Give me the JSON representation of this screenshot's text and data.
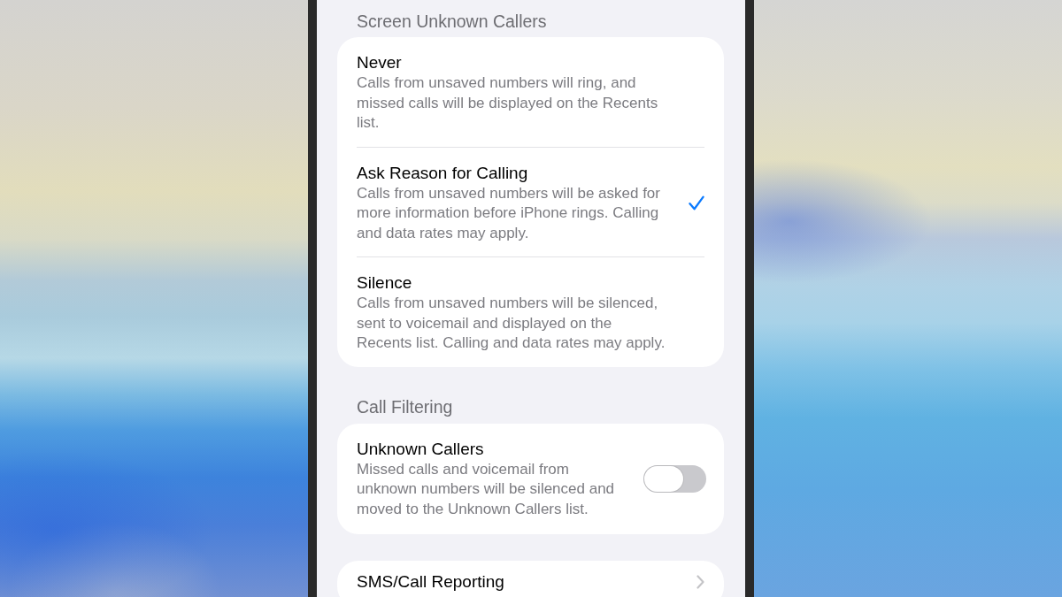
{
  "screen_unknown_callers": {
    "header": "Screen Unknown Callers",
    "options": [
      {
        "title": "Never",
        "description": "Calls from unsaved numbers will ring, and missed calls will be displayed on the Recents list.",
        "selected": false
      },
      {
        "title": "Ask Reason for Calling",
        "description": "Calls from unsaved numbers will be asked for more information before iPhone rings. Calling and data rates may apply.",
        "selected": true
      },
      {
        "title": "Silence",
        "description": "Calls from unsaved numbers will be silenced, sent to voicemail and displayed on the Recents list. Calling and data rates may apply.",
        "selected": false
      }
    ]
  },
  "call_filtering": {
    "header": "Call Filtering",
    "title": "Unknown Callers",
    "description": "Missed calls and voicemail from unknown numbers will be silenced and moved to the Unknown Callers list.",
    "on": false
  },
  "sms_call_reporting": {
    "title": "SMS/Call Reporting"
  }
}
